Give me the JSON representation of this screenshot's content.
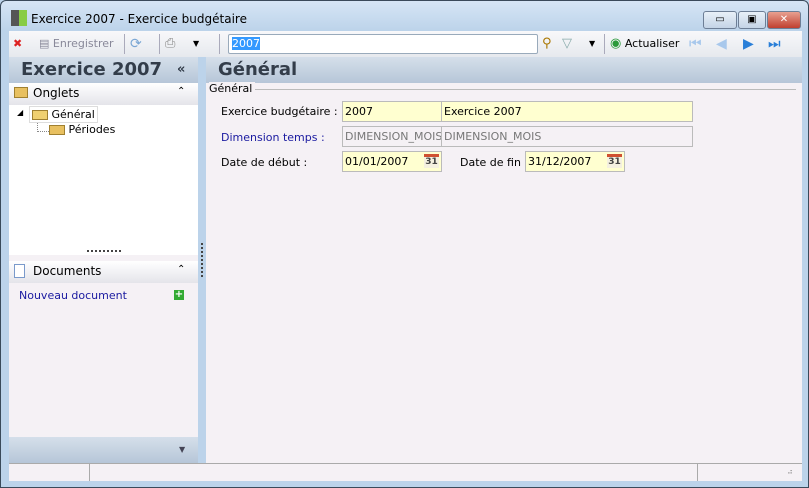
{
  "window": {
    "title": "Exercice 2007 -  Exercice budgétaire"
  },
  "toolbar": {
    "save_label": "Enregistrer",
    "search_value": "2007",
    "refresh_label": "Actualiser"
  },
  "left_panel": {
    "title": "Exercice 2007",
    "collapse": "«",
    "tabs_section": "Onglets",
    "tree": [
      {
        "label": "Général"
      },
      {
        "label": "Périodes"
      }
    ],
    "documents_section": "Documents",
    "new_document": "Nouveau document"
  },
  "main": {
    "title": "Général",
    "group": "Général",
    "fields": {
      "exercice_label": "Exercice budgétaire :",
      "exercice_code": "2007",
      "exercice_name": "Exercice 2007",
      "dimension_label": "Dimension temps :",
      "dimension_code": "DIMENSION_MOIS",
      "dimension_name": "DIMENSION_MOIS",
      "start_label": "Date de début :",
      "start_value": "01/01/2007",
      "end_label": "Date de fin :",
      "end_value": "31/12/2007",
      "calendar_day": "31"
    }
  },
  "colors": {
    "link": "#1a1aa0",
    "field": "#ffffd0"
  }
}
